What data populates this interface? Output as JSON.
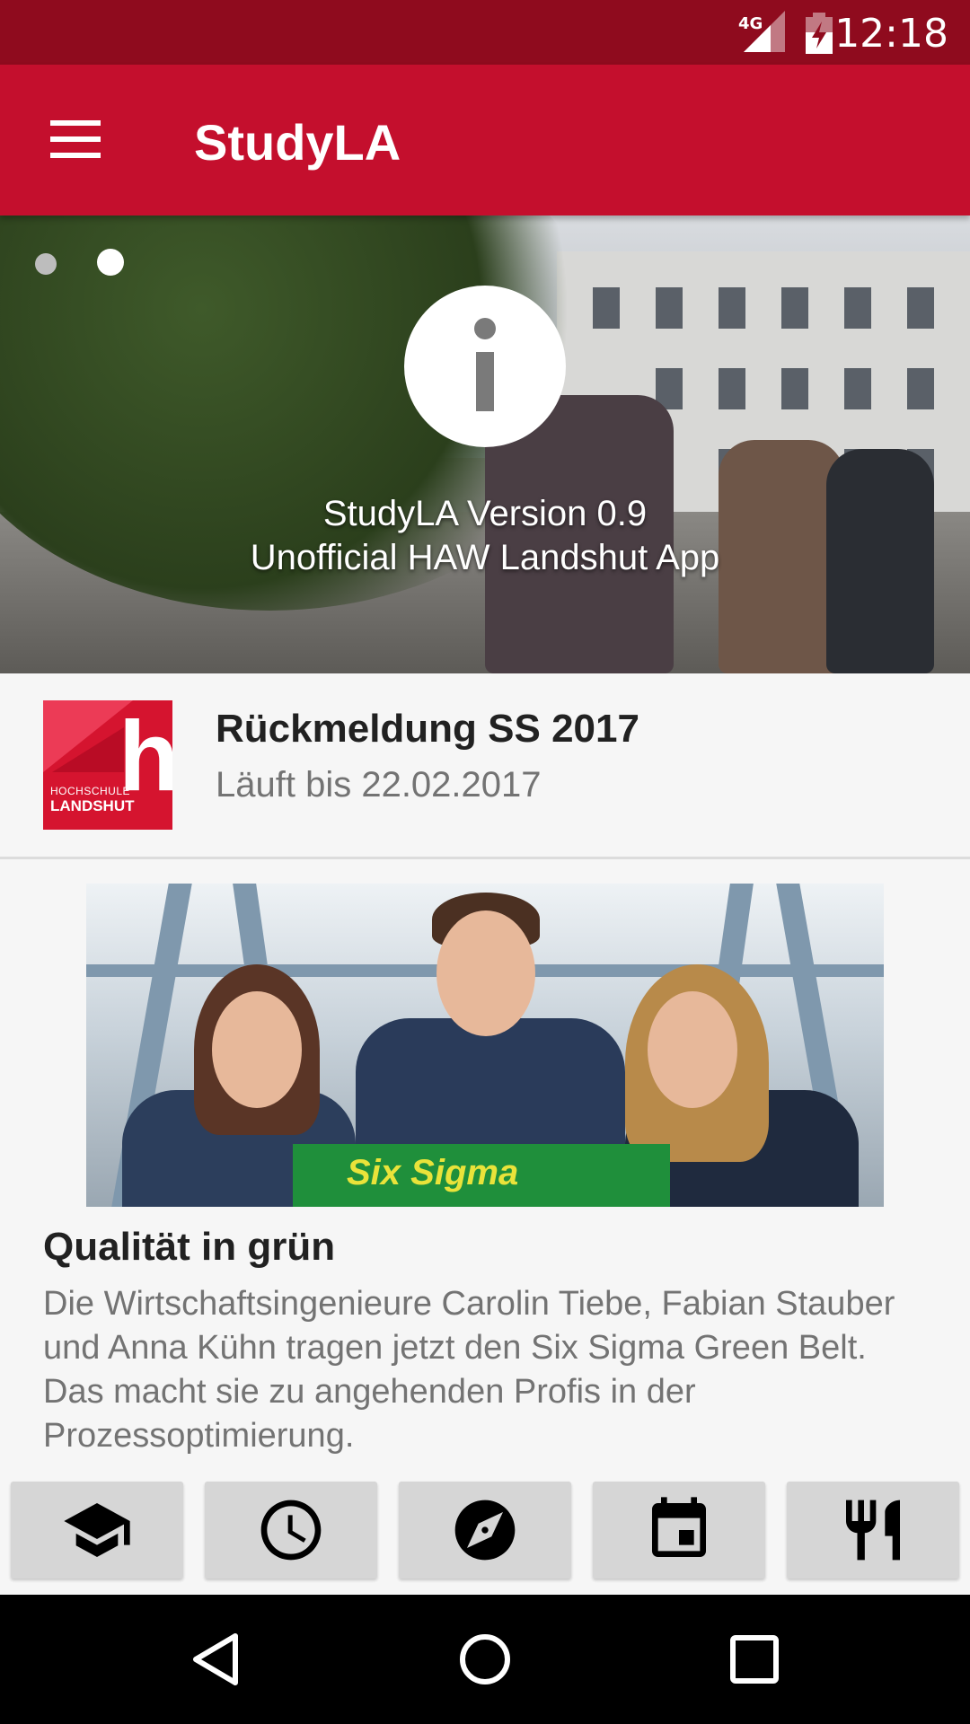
{
  "status_bar": {
    "time": "12:18",
    "network": "4G"
  },
  "app_bar": {
    "title": "StudyLA",
    "menu_icon": "hamburger-menu-icon"
  },
  "hero": {
    "caption_line1": "StudyLA Version 0.9",
    "caption_line2": "Unofficial HAW Landshut App",
    "page_count": 2,
    "active_page": 2
  },
  "notice": {
    "logo_text_top": "HOCHSCHULE",
    "logo_text_bottom": "LANDSHUT",
    "title": "Rückmeldung SS 2017",
    "subtitle": "Läuft bis 22.02.2017"
  },
  "news": {
    "image_label": "Six Sigma",
    "title": "Qualität in grün",
    "body": "Die Wirtschaftsingenieure Carolin Tiebe, Fabian Stauber und Anna Kühn tragen jetzt den Six Sigma Green Belt. Das macht sie zu angehenden Profis in der Prozessoptimierung."
  },
  "bottom_buttons": [
    {
      "icon": "graduation-cap-icon"
    },
    {
      "icon": "clock-icon"
    },
    {
      "icon": "compass-icon"
    },
    {
      "icon": "calendar-icon"
    },
    {
      "icon": "restaurant-icon"
    }
  ],
  "colors": {
    "status_bar": "#8f0b1e",
    "app_bar": "#c40f2d",
    "background": "#f6f6f6",
    "button": "#d6d6d6"
  }
}
